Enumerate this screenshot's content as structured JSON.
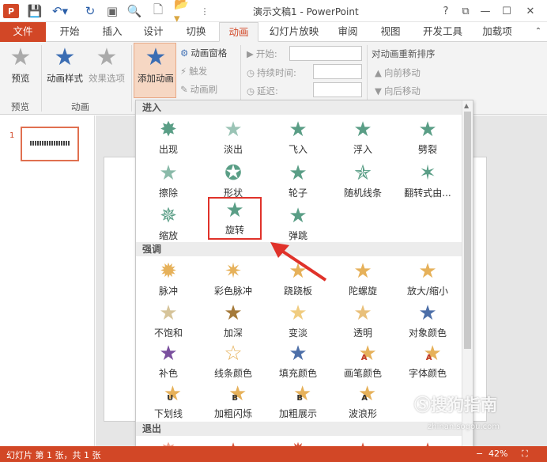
{
  "titlebar": {
    "app_icon": "P",
    "title": "演示文稿1 - PowerPoint",
    "help": "?",
    "restore": "⧉",
    "minimize": "—",
    "maximize": "☐",
    "close": "✕"
  },
  "tabs": {
    "file": "文件",
    "home": "开始",
    "insert": "插入",
    "design": "设计",
    "transitions": "切换",
    "animations": "动画",
    "slideshow": "幻灯片放映",
    "review": "审阅",
    "view": "视图",
    "developer": "开发工具",
    "addins": "加载项"
  },
  "ribbon": {
    "preview": "预览",
    "preview_group": "预览",
    "animation_styles": "动画样式",
    "effect_options": "效果选项",
    "animation_group": "动画",
    "add_animation": "添加动画",
    "animation_pane": "动画窗格",
    "trigger": "触发",
    "animation_painter": "动画刷",
    "start_label": "开始:",
    "duration_label": "持续时间:",
    "delay_label": "延迟:",
    "reorder_title": "对动画重新排序",
    "move_earlier": "向前移动",
    "move_later": "向后移动"
  },
  "slides": {
    "number": "1"
  },
  "dropdown": {
    "enter_header": "进入",
    "emphasis_header": "强调",
    "exit_header": "退出",
    "enter_items": [
      "出现",
      "淡出",
      "飞入",
      "浮入",
      "劈裂",
      "擦除",
      "形状",
      "轮子",
      "随机线条",
      "翻转式由...",
      "缩放",
      "旋转",
      "弹跳"
    ],
    "emphasis_items": [
      "脉冲",
      "彩色脉冲",
      "跷跷板",
      "陀螺旋",
      "放大/缩小",
      "不饱和",
      "加深",
      "变淡",
      "透明",
      "对象颜色",
      "补色",
      "线条颜色",
      "填充颜色",
      "画笔颜色",
      "字体颜色",
      "下划线",
      "加粗闪烁",
      "加粗展示",
      "波浪形"
    ],
    "emphasis_letters": [
      "A",
      "A",
      "U",
      "B",
      "B",
      "A"
    ],
    "selected": "旋转"
  },
  "statusbar": {
    "slide_info": "幻灯片 第 1 张，共 1 张",
    "zoom": "42%"
  },
  "watermark": {
    "brand": "搜狗指南",
    "url": "zhinan.sogou.com"
  },
  "colors": {
    "accent": "#d24726",
    "enter_star": "#5a9e86",
    "emphasis_star": "#e6b15a",
    "exit_star": "#d9573c",
    "highlight_border": "#e0322a"
  }
}
